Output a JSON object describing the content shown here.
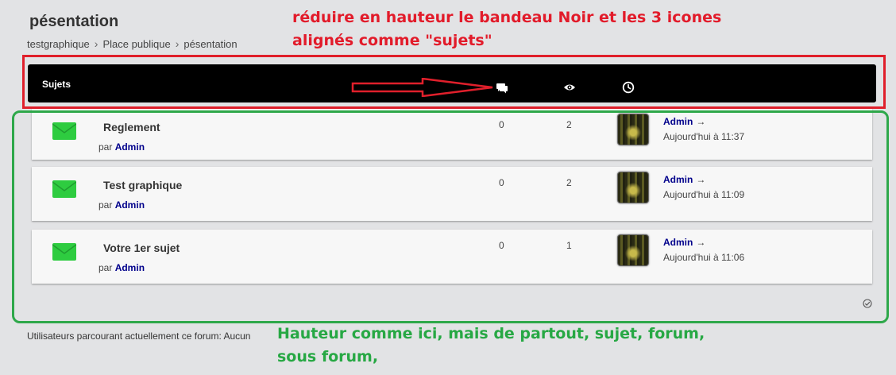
{
  "forum": {
    "title": "pésentation",
    "breadcrumb": [
      "testgraphique",
      "Place publique",
      "pésentation"
    ],
    "breadcrumb_sep": "›"
  },
  "annotations": {
    "red_line1": "réduire en hauteur le bandeau Noir et les 3 icones",
    "red_line2": "alignés comme \"sujets\"",
    "green_line1": "Hauteur comme ici, mais de partout, sujet, forum,",
    "green_line2": "sous forum,",
    "red_color": "#e21b2a",
    "green_color": "#27a844"
  },
  "header": {
    "label": "Sujets",
    "icons": [
      "replies-icon",
      "views-icon",
      "last-post-clock-icon"
    ]
  },
  "topics": [
    {
      "title": "Reglement",
      "by_prefix": "par",
      "author": "Admin",
      "replies": "0",
      "views": "2",
      "last_user": "Admin",
      "last_arrow": "→",
      "last_time": "Aujourd'hui à 11:37"
    },
    {
      "title": "Test graphique",
      "by_prefix": "par",
      "author": "Admin",
      "replies": "0",
      "views": "2",
      "last_user": "Admin",
      "last_arrow": "→",
      "last_time": "Aujourd'hui à 11:09"
    },
    {
      "title": "Votre 1er sujet",
      "by_prefix": "par",
      "author": "Admin",
      "replies": "0",
      "views": "1",
      "last_user": "Admin",
      "last_arrow": "→",
      "last_time": "Aujourd'hui à 11:06"
    }
  ],
  "footer": {
    "viewers": "Utilisateurs parcourant actuellement ce forum: Aucun"
  },
  "colors": {
    "author_link": "#00008b",
    "envelope": "#2ecc40",
    "header_bg": "#000000"
  }
}
